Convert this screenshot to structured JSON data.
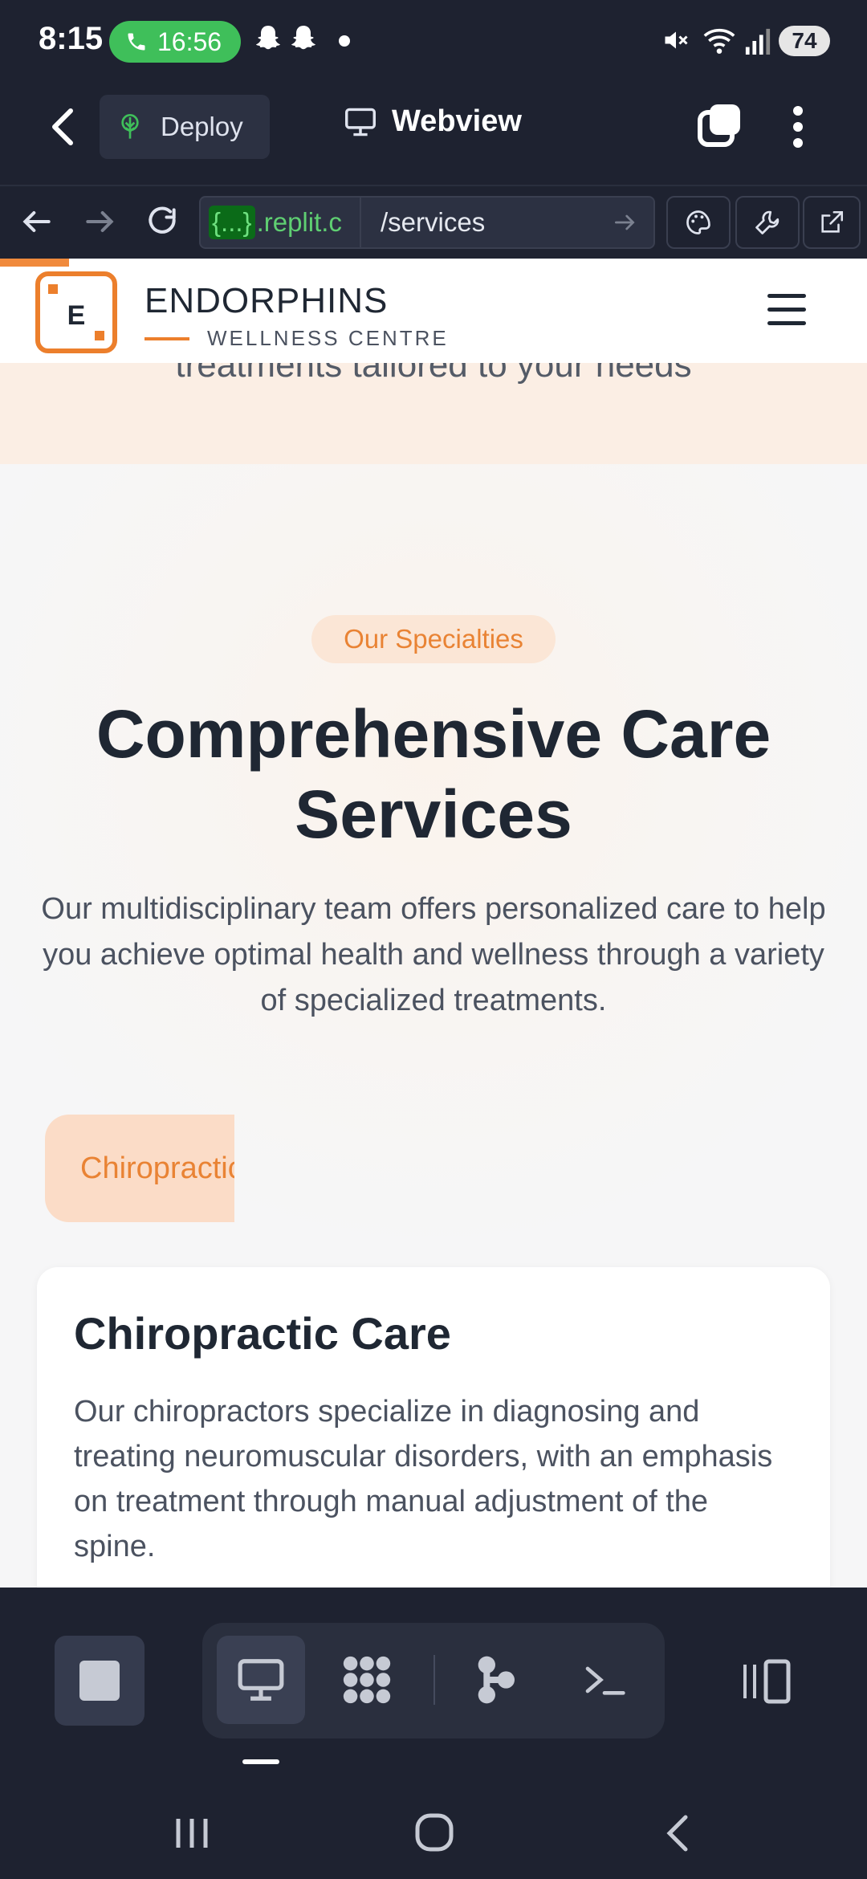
{
  "status_bar": {
    "time": "8:15",
    "call_duration": "16:56",
    "battery": "74"
  },
  "app_bar": {
    "deploy_label": "Deploy",
    "title": "Webview"
  },
  "url_bar": {
    "domain_brace": "{...}",
    "domain": ".replit.c",
    "path": "/services"
  },
  "site": {
    "hero_tail": "treatments tailored to your needs",
    "logo_letter": "E",
    "brand_name": "ENDORPHINS",
    "brand_sub": "WELLNESS CENTRE",
    "badge": "Our Specialties",
    "title": "Comprehensive Care Services",
    "description": "Our multidisciplinary team offers personalized care to help you achieve optimal health and wellness through a variety of specialized treatments.",
    "tab_label": "Chiropractic Care",
    "card_title": "Chiropractic Care",
    "card_body": "Our chiropractors specialize in diagnosing and treating neuromuscular disorders, with an emphasis on treatment through manual adjustment of the spine."
  },
  "colors": {
    "accent": "#ec7f2c",
    "ide_bg": "#1e2230",
    "call_green": "#3fbf5a"
  },
  "icons": {
    "back": "chevron-left-icon",
    "deploy": "deploy-tree-icon",
    "webview": "monitor-icon",
    "tabs": "tabs-switcher-icon",
    "more": "more-vertical-icon"
  }
}
